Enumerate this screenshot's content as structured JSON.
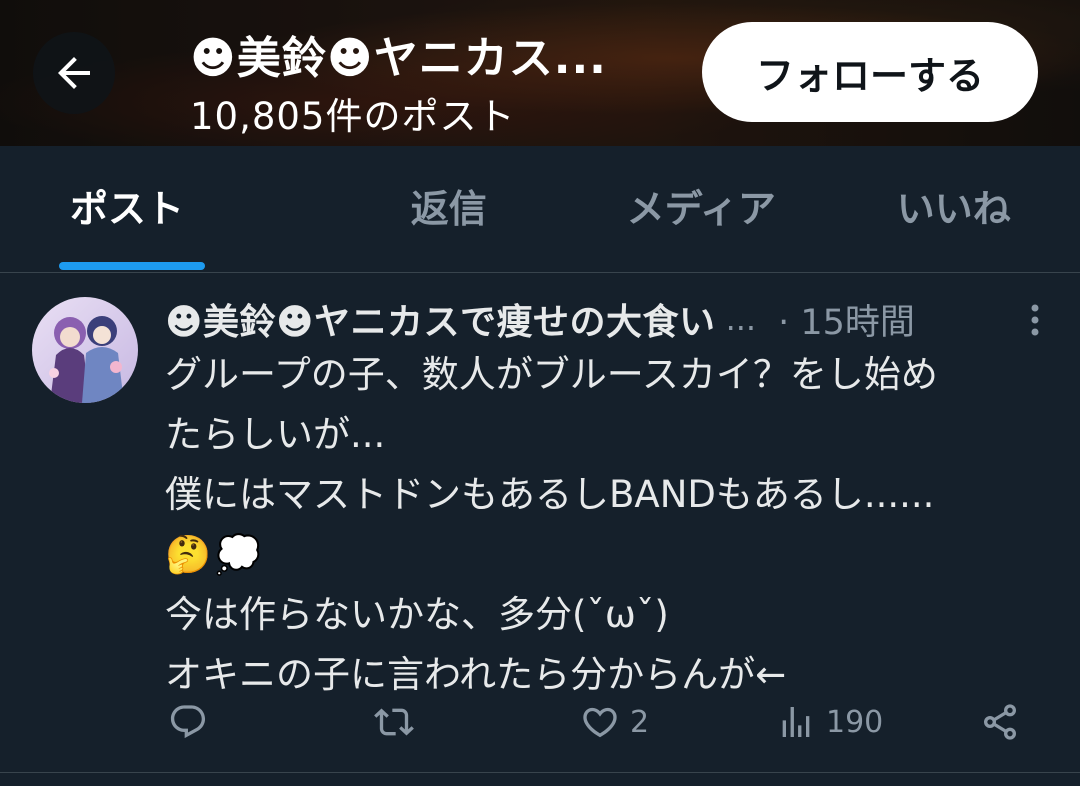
{
  "header": {
    "title": "☻美鈴☻ヤニカス...",
    "post_count": "10,805件のポスト",
    "follow_label": "フォローする"
  },
  "tabs": [
    {
      "label": "ポスト",
      "active": true
    },
    {
      "label": "返信",
      "active": false
    },
    {
      "label": "メディア",
      "active": false
    },
    {
      "label": "いいね",
      "active": false
    }
  ],
  "post": {
    "author": "☻美鈴☻ヤニカスで痩せの大食い",
    "ellipsis": "...",
    "time": "· 15時間",
    "lines": [
      "グループの子、数人がブルースカイ？をし始め",
      "たらしいが...",
      "僕にはマストドンもあるしBANDもあるし......",
      "今は作らないかな、多分(ˇωˇ)",
      "オキニの子に言われたら分からんが←"
    ],
    "emojis": [
      "🤔",
      "💭"
    ],
    "likes": "2",
    "views": "190"
  },
  "colors": {
    "accent": "#1d9bf0",
    "background": "#15202b",
    "muted": "#8b98a5"
  }
}
